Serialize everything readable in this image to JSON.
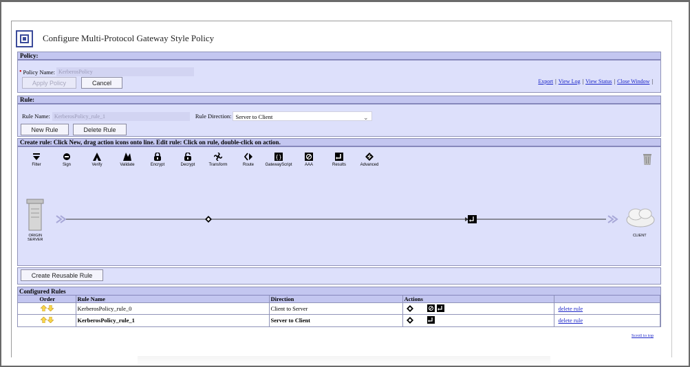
{
  "title": "Configure Multi-Protocol Gateway Style Policy",
  "policy": {
    "header": "Policy:",
    "name_label": "Policy Name:",
    "name_value": "KerberosPolicy",
    "apply_label": "Apply Policy",
    "cancel_label": "Cancel",
    "links": [
      "Export",
      "View Log",
      "View Status",
      "Close Window"
    ]
  },
  "rule": {
    "header": "Rule:",
    "name_label": "Rule Name:",
    "name_value": "KerberosPolicy_rule_1",
    "direction_label": "Rule Direction:",
    "direction_value": "Server to Client",
    "new_rule_label": "New Rule",
    "delete_rule_label": "Delete Rule"
  },
  "editor": {
    "header": "Create rule: Click New, drag action icons onto line.   Edit rule: Click on rule, double-click on action.",
    "actions": [
      "Filter",
      "Sign",
      "Verify",
      "Validate",
      "Encrypt",
      "Decrypt",
      "Transform",
      "Route",
      "GatewayScript",
      "AAA",
      "Results",
      "Advanced"
    ],
    "origin_label_1": "ORIGIN",
    "origin_label_2": "SERVER",
    "client_label": "CLIENT"
  },
  "reusable": {
    "button_label": "Create Reusable Rule"
  },
  "configured": {
    "header": "Configured Rules",
    "columns": [
      "Order",
      "Rule Name",
      "Direction",
      "Actions",
      ""
    ],
    "rows": [
      {
        "name": "KerberosPolicy_rule_0",
        "direction": "Client to Server",
        "delete": "delete rule"
      },
      {
        "name": "KerberosPolicy_rule_1",
        "direction": "Server to Client",
        "delete": "delete rule"
      }
    ],
    "scroll_top": "Scroll to top"
  }
}
